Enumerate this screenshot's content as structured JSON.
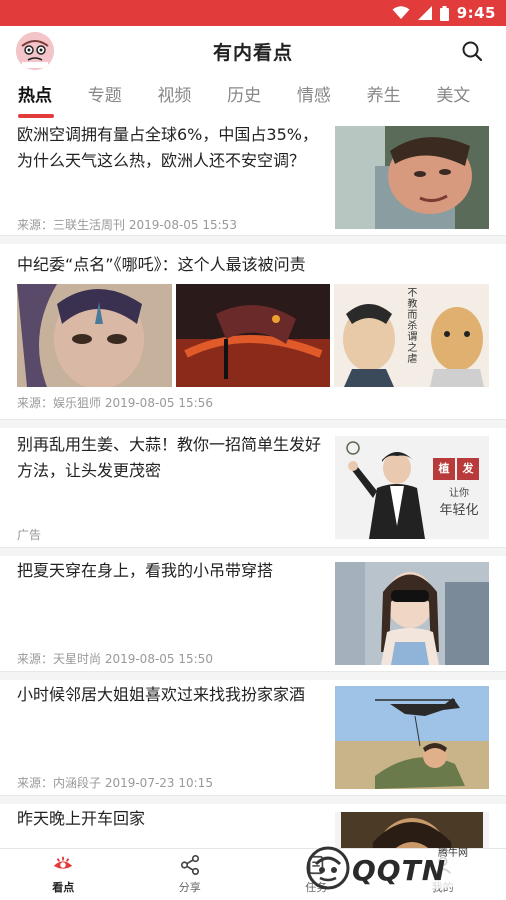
{
  "status": {
    "time": "9:45"
  },
  "header": {
    "title": "有内看点"
  },
  "tabs": [
    "热点",
    "专题",
    "视频",
    "历史",
    "情感",
    "养生",
    "美文"
  ],
  "feed": [
    {
      "title": "欧洲空调拥有量占全球6%，中国占35%，为什么天气这么热，欧洲人还不安空调？",
      "meta": "来源：三联生活周刊  2019-08-05 15:53"
    },
    {
      "title": "中纪委“点名”《哪吒》：这个人最该被问责",
      "meta": "来源：娱乐狙师  2019-08-05 15:56",
      "image3_text": [
        "不",
        "教",
        "而",
        "杀",
        "谓",
        "之",
        "虐"
      ]
    },
    {
      "title": "别再乱用生姜、大蒜！教你一招简单生发好方法，让头发更茂密",
      "meta": "广告",
      "ad_badge": [
        "植",
        "发"
      ],
      "ad_tagline": [
        "让你",
        "年轻化"
      ]
    },
    {
      "title": "把夏天穿在身上，看我的小吊带穿搭",
      "meta": "来源：天星时尚  2019-08-05 15:50"
    },
    {
      "title": "小时候邻居大姐姐喜欢过来找我扮家家酒",
      "meta": "来源：内涵段子  2019-07-23 10:15"
    },
    {
      "title": "昨天晚上开车回家"
    }
  ],
  "bottom_nav": [
    {
      "label": "看点",
      "icon": "eye-icon"
    },
    {
      "label": "分享",
      "icon": "share-icon"
    },
    {
      "label": "任务",
      "icon": "task-icon"
    },
    {
      "label": "我的",
      "icon": "user-icon"
    }
  ],
  "watermark": {
    "text": "QQTN",
    "sub": "腾牛网"
  },
  "colors": {
    "accent": "#e23b3b"
  }
}
